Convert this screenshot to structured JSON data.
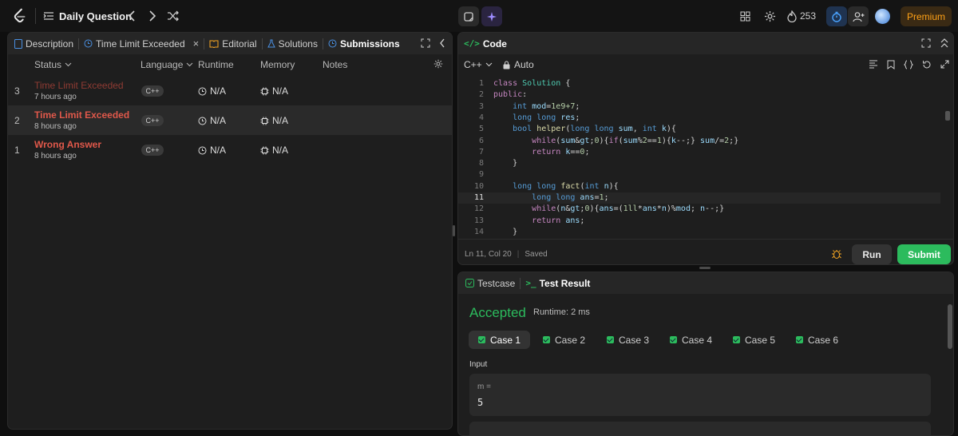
{
  "topbar": {
    "title": "Daily Question",
    "streak_count": "253",
    "premium_label": "Premium"
  },
  "left_panel": {
    "tabs": [
      {
        "label": "Description"
      },
      {
        "label": "Time Limit Exceeded"
      },
      {
        "label": "Editorial"
      },
      {
        "label": "Solutions"
      },
      {
        "label": "Submissions"
      }
    ],
    "columns": {
      "status": "Status",
      "language": "Language",
      "runtime": "Runtime",
      "memory": "Memory",
      "notes": "Notes"
    },
    "rows": [
      {
        "index": "3",
        "status": "Time Limit Exceeded",
        "time": "7 hours ago",
        "lang": "C++",
        "runtime": "N/A",
        "memory": "N/A"
      },
      {
        "index": "2",
        "status": "Time Limit Exceeded",
        "time": "8 hours ago",
        "lang": "C++",
        "runtime": "N/A",
        "memory": "N/A"
      },
      {
        "index": "1",
        "status": "Wrong Answer",
        "time": "8 hours ago",
        "lang": "C++",
        "runtime": "N/A",
        "memory": "N/A"
      }
    ]
  },
  "code_panel": {
    "title": "Code",
    "language": "C++",
    "mode": "Auto",
    "status": "Ln 11, Col 20",
    "saved": "Saved",
    "run_label": "Run",
    "submit_label": "Submit",
    "lines": [
      {
        "n": "1",
        "text": "class Solution {"
      },
      {
        "n": "2",
        "text": "public:"
      },
      {
        "n": "3",
        "text": "    int mod=1e9+7;"
      },
      {
        "n": "4",
        "text": "    long long res;"
      },
      {
        "n": "5",
        "text": "    bool helper(long long sum, int k){"
      },
      {
        "n": "6",
        "text": "        while(sum>0){if(sum%2==1){k--;} sum/=2;}"
      },
      {
        "n": "7",
        "text": "        return k==0;"
      },
      {
        "n": "8",
        "text": "    }"
      },
      {
        "n": "9",
        "text": ""
      },
      {
        "n": "10",
        "text": "    long long fact(int n){"
      },
      {
        "n": "11",
        "text": "        long long ans=1;"
      },
      {
        "n": "12",
        "text": "        while(n>0){ans=(1ll*ans*n)%mod; n--;}"
      },
      {
        "n": "13",
        "text": "        return ans;"
      },
      {
        "n": "14",
        "text": "    }"
      }
    ]
  },
  "result_panel": {
    "tab_testcase": "Testcase",
    "tab_result": "Test Result",
    "verdict": "Accepted",
    "runtime": "Runtime: 2 ms",
    "cases": [
      "Case 1",
      "Case 2",
      "Case 3",
      "Case 4",
      "Case 5",
      "Case 6"
    ],
    "input_label": "Input",
    "var_name": "m =",
    "var_value": "5"
  },
  "colors": {
    "tle": "#e0584a",
    "accepted": "#2cbb5d",
    "premium": "#ffa116"
  }
}
